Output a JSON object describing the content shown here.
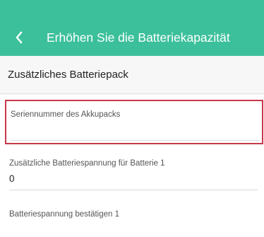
{
  "header": {
    "back_icon": "chevron-left-icon",
    "title": "Erhöhen Sie die Batteriekapazität",
    "background_color": "#3cc09b"
  },
  "section": {
    "title": "Zusätzliches Batteriepack"
  },
  "form": {
    "serial_number": {
      "label": "Seriennummer des Akkupacks",
      "value": "",
      "highlight_color": "#c8384b"
    },
    "battery_voltage": {
      "label": "Zusätzliche Batteriespannung für Batterie 1",
      "value": "0"
    },
    "confirm_voltage": {
      "label": "Batteriespannung bestätigen 1",
      "value": ""
    }
  }
}
